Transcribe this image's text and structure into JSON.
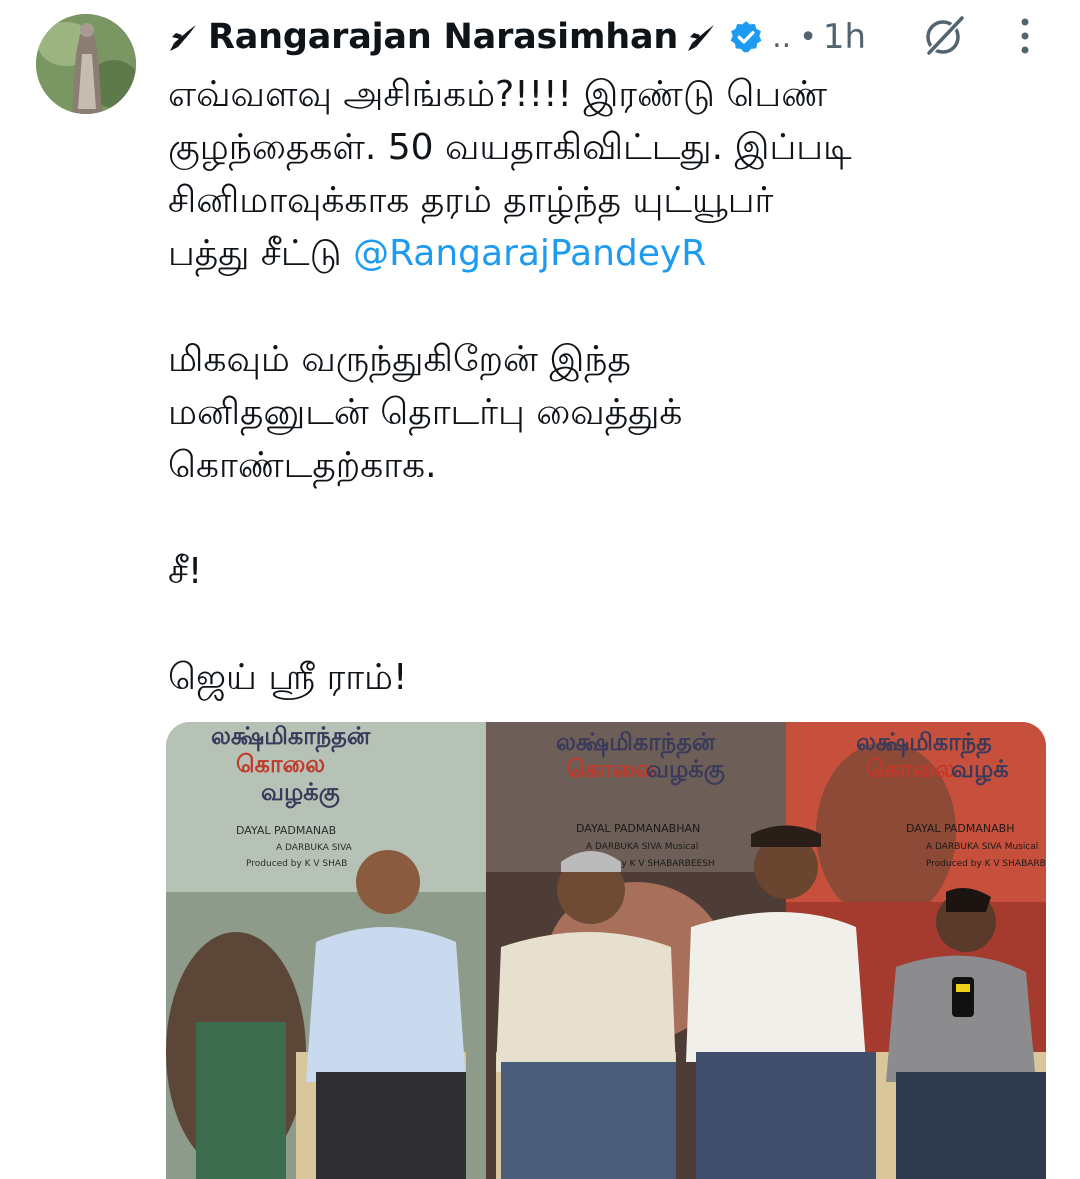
{
  "author": {
    "display_name": "Rangarajan Narasimhan",
    "handle_truncated": "..",
    "separator": "•",
    "time": "1h"
  },
  "tweet": {
    "lines_p1": [
      "எவ்வளவு அசிங்கம்?!!!! இரண்டு பெண்",
      "குழந்தைகள். 50 வயதாகிவிட்டது.  இப்படி",
      "சினிமாவுக்காக தரம் தாழ்ந்த யுட்யூபர்"
    ],
    "line4_prefix": "பத்து சீட்டு ",
    "mention": "@RangarajPandeyR",
    "lines_p2": [
      "மிகவும் வருந்துகிறேன் இந்த",
      "மனிதனுடன் தொடர்பு வைத்துக்",
      "கொண்டதற்காக."
    ],
    "line_p3": "சீ!",
    "line_p4": "ஜெய் ஸ்ரீ ராம்!"
  },
  "media": {
    "posters": [
      {
        "title_line1": "லக்ஷ்மிகாந்தன்",
        "title_line2": "கொலை",
        "title_line3": "வழக்கு",
        "credit1": "DAYAL PADMANAB",
        "credit2": "A DARBUKA SIVA",
        "credit3": "Produced by K V SHAB"
      },
      {
        "title_line1": "லக்ஷ்மிகாந்தன்",
        "title_line2": "கொலை",
        "title_line3": "வழக்கு",
        "credit1": "DAYAL PADMANABHAN",
        "credit2": "A DARBUKA SIVA Musical",
        "credit3": "Produced by K V SHABARBEESH"
      },
      {
        "title_line1": "லக்ஷ்மிகாந்த",
        "title_line2": "கொலை",
        "title_line3": "வழக்",
        "credit1": "DAYAL PADMANABH",
        "credit2": "A DARBUKA SIVA Musical",
        "credit3": "Produced by K V SHABARBEESH"
      }
    ]
  },
  "icons": {
    "rocket": "rocket-icon",
    "verified": "verified-badge-icon",
    "grok": "grok-icon",
    "more": "more-vertical-icon"
  },
  "colors": {
    "text": "#0f1419",
    "secondary": "#536471",
    "accent": "#1d9bf0"
  }
}
